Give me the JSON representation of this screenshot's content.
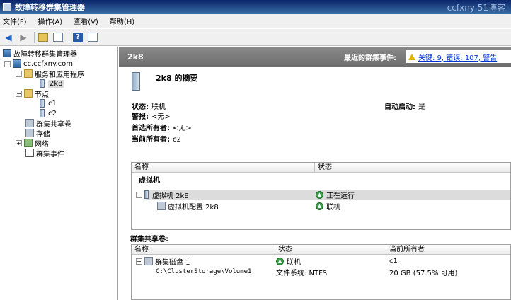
{
  "window": {
    "title": "故障转移群集管理器",
    "watermark": "ccfxny 51博客"
  },
  "menu": [
    "文件(F)",
    "操作(A)",
    "查看(V)",
    "帮助(H)"
  ],
  "tree": {
    "root": "故障转移群集管理器",
    "cluster": "cc.ccfxny.com",
    "services": "服务和应用程序",
    "service_item": "2k8",
    "nodes": "节点",
    "node1": "c1",
    "node2": "c2",
    "csv": "群集共享卷",
    "storage": "存储",
    "network": "网络",
    "events": "群集事件"
  },
  "header": {
    "title": "2k8",
    "events_label": "最近的群集事件:",
    "events_value": "关键: 9, 错误: 107, 警告"
  },
  "summary": {
    "title": "2k8 的摘要",
    "status_label": "状态:",
    "status_value": "联机",
    "alert_label": "警报:",
    "alert_value": "<无>",
    "preferred_label": "首选所有者:",
    "preferred_value": "<无>",
    "current_label": "当前所有者:",
    "current_value": "c2",
    "autostart_label": "自动启动:",
    "autostart_value": "是"
  },
  "resources": {
    "columns": [
      "名称",
      "状态"
    ],
    "group": "虚拟机",
    "rows": [
      {
        "name": "虚拟机 2k8",
        "status": "正在运行"
      },
      {
        "name": "虚拟机配置 2k8",
        "status": "联机"
      }
    ]
  },
  "csv_section": {
    "title": "群集共享卷:",
    "columns": [
      "名称",
      "状态",
      "当前所有者"
    ],
    "disk": {
      "name": "群集磁盘 1",
      "status": "联机",
      "owner": "c1"
    },
    "volume": {
      "path": "C:\\ClusterStorage\\Volume1",
      "fs": "文件系统: NTFS",
      "capacity": "20 GB (57.5% 可用)"
    }
  },
  "colors": {
    "title_bar": "#0a246a",
    "header_bar": "#7a7a7a",
    "link": "#0033cc",
    "online": "#3aa14a"
  }
}
